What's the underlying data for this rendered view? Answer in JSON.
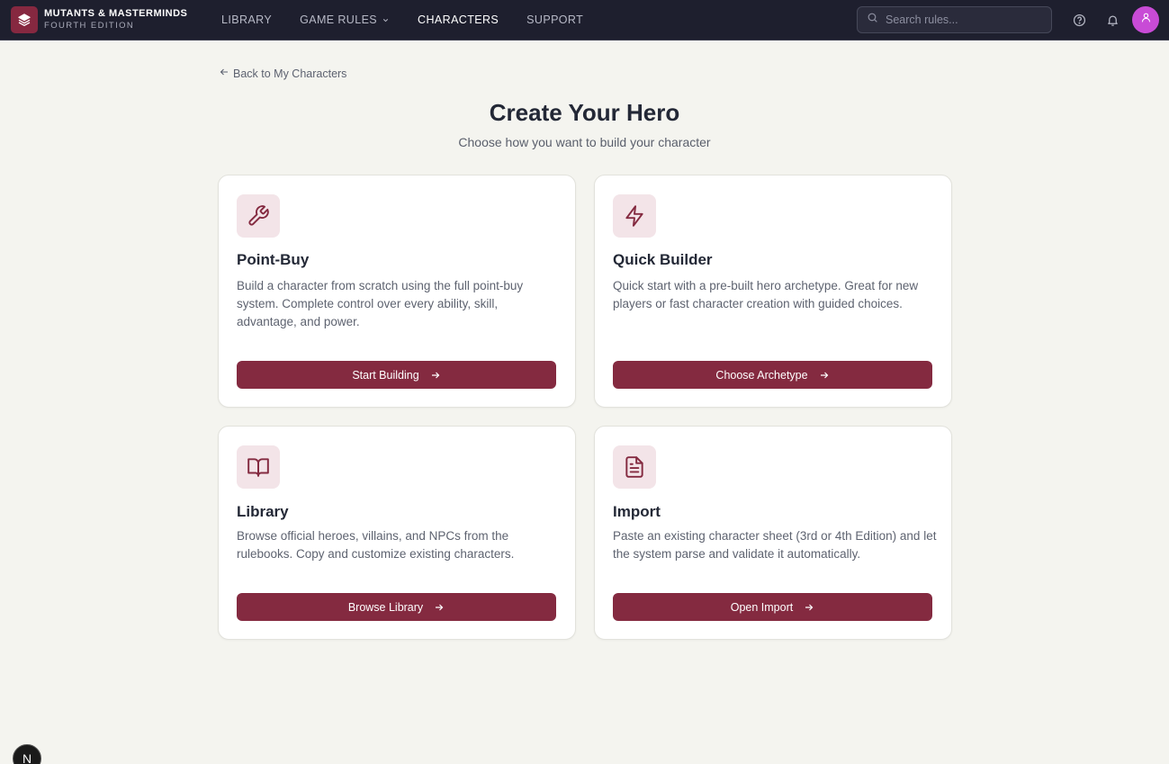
{
  "brand": {
    "title": "MUTANTS & MASTERMINDS",
    "subtitle": "FOURTH EDITION",
    "logo_icon": "layers-icon"
  },
  "nav": {
    "items": [
      {
        "label": "LIBRARY",
        "active": false
      },
      {
        "label": "GAME RULES",
        "active": false,
        "has_dropdown": true
      },
      {
        "label": "CHARACTERS",
        "active": true
      },
      {
        "label": "SUPPORT",
        "active": false
      }
    ]
  },
  "search": {
    "placeholder": "Search rules..."
  },
  "header_icons": [
    "help-icon",
    "bell-icon",
    "user-icon"
  ],
  "back_link": "Back to My Characters",
  "page": {
    "title": "Create Your Hero",
    "subtitle": "Choose how you want to build your character"
  },
  "cards": [
    {
      "icon": "wrench-icon",
      "title": "Point-Buy",
      "description": "Build a character from scratch using the full point-buy system. Complete control over every ability, skill, advantage, and power.",
      "button": "Start Building"
    },
    {
      "icon": "lightning-icon",
      "title": "Quick Builder",
      "description": "Quick start with a pre-built hero archetype. Great for new players or fast character creation with guided choices.",
      "button": "Choose Archetype"
    },
    {
      "icon": "book-icon",
      "title": "Library",
      "description": "Browse official heroes, villains, and NPCs from the rulebooks. Copy and customize existing characters.",
      "button": "Browse Library"
    },
    {
      "icon": "document-icon",
      "title": "Import",
      "description": "Paste an existing character sheet (3rd or 4th Edition) and let the system parse and validate it automatically.",
      "button": "Open Import"
    }
  ],
  "fab_label": "N",
  "colors": {
    "topbar": "#1e1f2e",
    "accent": "#842a40",
    "icon_bg": "#f3e4e8",
    "page_bg": "#f4f4ef",
    "avatar": "#c84bd6"
  }
}
